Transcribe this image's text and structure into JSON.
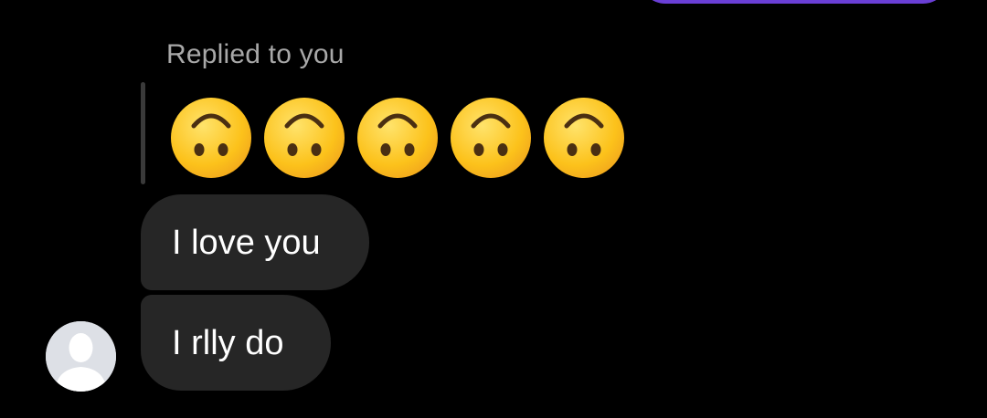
{
  "colors": {
    "background": "#000000",
    "sent_bubble": "#6a3fd6",
    "received_bubble": "#262626",
    "reply_label": "#a8a8a8",
    "reply_bar": "#3a3a3a",
    "message_text": "#ffffff",
    "avatar_bg": "#dde0e6"
  },
  "reply": {
    "label": "Replied to you",
    "emojis": [
      "upside-down-face-emoji",
      "upside-down-face-emoji",
      "upside-down-face-emoji",
      "upside-down-face-emoji",
      "upside-down-face-emoji"
    ]
  },
  "messages": [
    {
      "text": "I love you"
    },
    {
      "text": "I rlly do"
    }
  ],
  "avatar": {
    "icon": "default-person-icon"
  }
}
